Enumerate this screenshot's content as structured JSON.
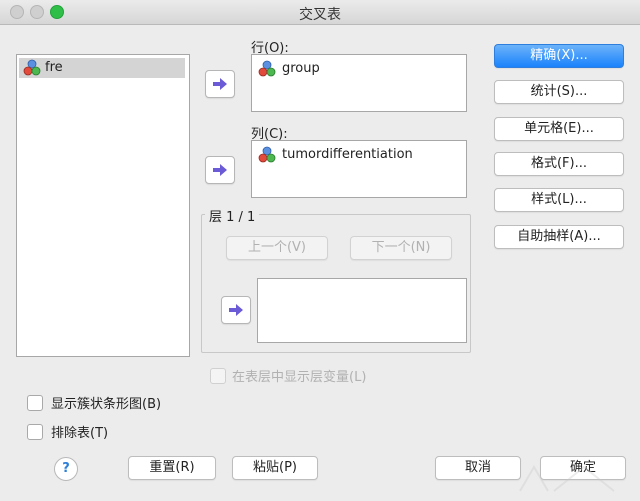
{
  "window": {
    "title": "交叉表"
  },
  "variables": [
    {
      "name": "fre",
      "icon": "nominal-variable-icon"
    }
  ],
  "rows": {
    "label": "行(O):",
    "items": [
      {
        "name": "group"
      }
    ]
  },
  "columns": {
    "label": "列(C):",
    "items": [
      {
        "name": "tumordifferentiation"
      }
    ]
  },
  "layer": {
    "title": "层 1 / 1",
    "prev_label": "上一个(V)",
    "next_label": "下一个(N)",
    "show_layer_var_label": "在表层中显示层变量(L)"
  },
  "side_buttons": {
    "exact": "精确(X)...",
    "statistics": "统计(S)...",
    "cells": "单元格(E)...",
    "format": "格式(F)...",
    "style": "样式(L)...",
    "bootstrap": "自助抽样(A)..."
  },
  "options": {
    "clustered_bar": "显示簇状条形图(B)",
    "suppress_tables": "排除表(T)"
  },
  "bottom_buttons": {
    "help": "?",
    "reset": "重置(R)",
    "paste": "粘贴(P)",
    "cancel": "取消",
    "ok": "确定"
  },
  "colors": {
    "accent": "#1a82fb",
    "arrow": "#6b5bd6"
  }
}
